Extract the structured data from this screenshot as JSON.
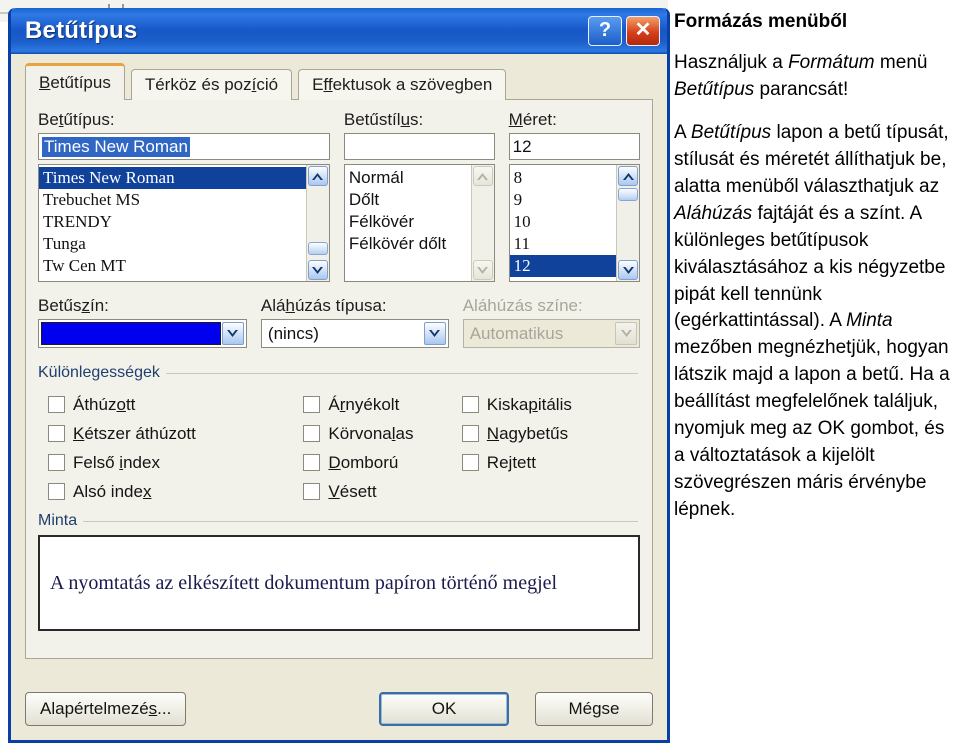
{
  "dialog": {
    "title": "Betűtípus",
    "caption_buttons": [
      {
        "name": "help-button",
        "glyph": "?"
      },
      {
        "name": "close-button",
        "glyph": "✕"
      }
    ],
    "tabs": [
      {
        "label": "Betűtípus",
        "accel": "B",
        "active": true
      },
      {
        "label": "Térköz és pozíció",
        "accel": "í",
        "active": false
      },
      {
        "label": "Effektusok a szövegben",
        "accel": "ff",
        "active": false
      }
    ],
    "font": {
      "label": "Betűtípus:",
      "accel": "t",
      "value": "Times New Roman",
      "items": [
        "Times New Roman",
        "Trebuchet MS",
        "TRENDY",
        "Tunga",
        "Tw Cen MT"
      ],
      "selected_index": 0
    },
    "style": {
      "label": "Betűstílus:",
      "accel": "u",
      "value": "",
      "items": [
        "Normál",
        "Dőlt",
        "Félkövér",
        "Félkövér dőlt"
      ],
      "selected_index": -1
    },
    "size": {
      "label": "Méret:",
      "accel": "M",
      "value": "12",
      "items": [
        "8",
        "9",
        "10",
        "11",
        "12"
      ],
      "selected_index": 4
    },
    "font_color": {
      "label": "Betűszín:",
      "accel": "z",
      "swatch_color": "#0000ee"
    },
    "underline_style": {
      "label": "Aláhúzás típusa:",
      "accel": "h",
      "value": "(nincs)"
    },
    "underline_color": {
      "label": "Aláhúzás színe:",
      "value": "Automatikus",
      "disabled": true
    },
    "effects": {
      "title": "Különlegességek",
      "columns": [
        [
          {
            "label_before": "Áthúz",
            "accel": "o",
            "label_after": "tt"
          },
          {
            "label_before": "",
            "accel": "K",
            "label_after": "étszer áthúzott"
          },
          {
            "label_before": "Felső ",
            "accel": "i",
            "label_after": "ndex"
          },
          {
            "label_before": "Alsó inde",
            "accel": "x",
            "label_after": ""
          }
        ],
        [
          {
            "label_before": "Á",
            "accel": "r",
            "label_after": "nyékolt"
          },
          {
            "label_before": "Körvona",
            "accel": "l",
            "label_after": "as"
          },
          {
            "label_before": "",
            "accel": "D",
            "label_after": "omború"
          },
          {
            "label_before": "",
            "accel": "V",
            "label_after": "ésett"
          }
        ],
        [
          {
            "label_before": "Kiska",
            "accel": "p",
            "label_after": "itális"
          },
          {
            "label_before": "",
            "accel": "N",
            "label_after": "agybetűs"
          },
          {
            "label_before": "Re",
            "accel": "j",
            "label_after": "tett"
          }
        ]
      ]
    },
    "preview": {
      "title": "Minta",
      "text": "A nyomtatás az elkészített dokumentum papíron történő megjel"
    },
    "buttons": {
      "defaults_before": "Alapértelmezé",
      "defaults_accel": "s",
      "defaults_after": "...",
      "ok": "OK",
      "cancel": "Mégse"
    }
  },
  "notes": {
    "heading": "Formázás menüből",
    "p1_a": "Használjuk a ",
    "p1_em1": "Formátum",
    "p1_b": " menü ",
    "p1_em2": "Betűtípus",
    "p1_c": " parancsát!",
    "p2_a": "A ",
    "p2_em1": "Betűtípus",
    "p2_b": " lapon a betű típusát, stílusát és méretét állíthatjuk be, alatta menüből választhatjuk az ",
    "p2_em2": "Aláhúzás",
    "p2_c": " fajtáját és a színt. A különleges betűtípusok kiválasztásához a kis négyzetbe pipát kell tennünk (egérkattintással). A ",
    "p2_em3": "Minta",
    "p2_d": " mezőben megnézhetjük, hogyan látszik majd a lapon a betű. Ha a beállítást megfelelőnek találjuk, nyomjuk meg az OK gombot, és a változtatások a kijelölt szövegrészen máris érvénybe lépnek."
  }
}
